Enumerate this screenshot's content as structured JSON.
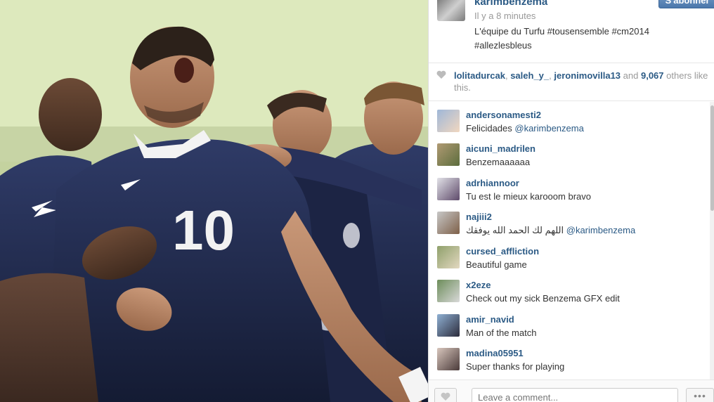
{
  "header": {
    "username": "karimbenzema",
    "follow_label": "S'abonner",
    "time": "Il y a 8 minutes",
    "caption_line1": "L'équipe du Turfu #tousensemble #cm2014",
    "caption_line2": "#allezlesbleus"
  },
  "likes": {
    "user1": "lolitadurcak",
    "user2": "saleh_y_",
    "user3": "jeronimovilla13",
    "and": "and",
    "count": "9,067",
    "suffix": "others like this."
  },
  "comments": [
    {
      "user": "andersonamesti2",
      "text": "Felicidades ",
      "mention": "@karimbenzema"
    },
    {
      "user": "aicuni_madrilen",
      "text": "Benzemaaaaaa",
      "mention": ""
    },
    {
      "user": "adrhiannoor",
      "text": "Tu est le mieux karooom bravo",
      "mention": ""
    },
    {
      "user": "najiii2",
      "text": "اللهم لك الحمد الله يوفقك ",
      "mention": "@karimbenzema"
    },
    {
      "user": "cursed_affliction",
      "text": "Beautiful game ",
      "mention": ""
    },
    {
      "user": "x2eze",
      "text": "Check out my sick Benzema GFX edit ",
      "mention": ""
    },
    {
      "user": "amir_navid",
      "text": "Man of the match",
      "mention": ""
    },
    {
      "user": "madina05951",
      "text": "Super  thanks for playing",
      "mention": ""
    }
  ],
  "comment_input": {
    "placeholder": "Leave a comment..."
  },
  "footer": {
    "more_label": "•••"
  },
  "photo": {
    "jersey_number": "10"
  },
  "colors": {
    "link": "#2b5a85",
    "follow": "#4b77ab"
  }
}
